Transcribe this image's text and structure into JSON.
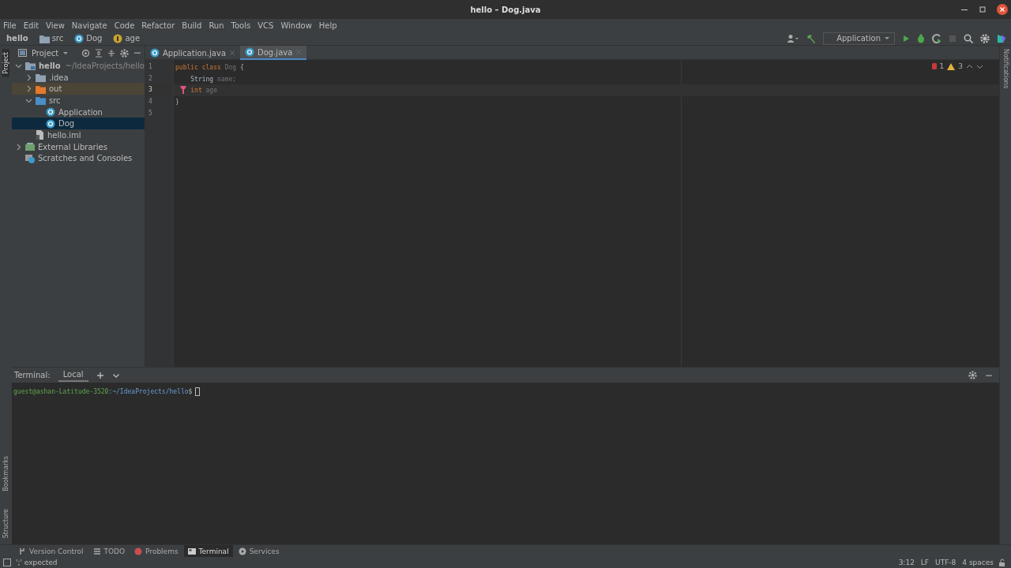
{
  "window": {
    "title": "hello – Dog.java"
  },
  "menu": [
    "File",
    "Edit",
    "View",
    "Navigate",
    "Code",
    "Refactor",
    "Build",
    "Run",
    "Tools",
    "VCS",
    "Window",
    "Help"
  ],
  "breadcrumbs": [
    {
      "label": "hello",
      "kind": "project"
    },
    {
      "label": "src",
      "kind": "folder"
    },
    {
      "label": "Dog",
      "kind": "class"
    },
    {
      "label": "age",
      "kind": "field"
    }
  ],
  "run_config": "Application",
  "left_strip_top": [
    {
      "label": "Project",
      "selected": true
    }
  ],
  "left_strip_bottom": [
    {
      "label": "Bookmarks",
      "selected": false
    },
    {
      "label": "Structure",
      "selected": false
    }
  ],
  "right_strip": [
    {
      "label": "Notifications"
    }
  ],
  "project_panel": {
    "title": "Project",
    "tree": [
      {
        "label": "hello",
        "hint": "~/IdeaProjects/hello",
        "kind": "module",
        "expanded": true,
        "selected": false,
        "children": [
          {
            "label": ".idea",
            "kind": "folder",
            "expanded": false,
            "selected": false
          },
          {
            "label": "out",
            "kind": "excluded",
            "expanded": false,
            "selected": false
          },
          {
            "label": "src",
            "kind": "source",
            "expanded": true,
            "selected": false,
            "children": [
              {
                "label": "Application",
                "kind": "class",
                "selected": false
              },
              {
                "label": "Dog",
                "kind": "class",
                "selected": true
              }
            ]
          },
          {
            "label": "hello.iml",
            "kind": "file",
            "selected": false
          }
        ]
      },
      {
        "label": "External Libraries",
        "kind": "libraries",
        "expanded": false,
        "selected": false
      },
      {
        "label": "Scratches and Consoles",
        "kind": "scratches",
        "selected": false
      }
    ]
  },
  "editor_tabs": [
    {
      "label": "Application.java",
      "selected": false
    },
    {
      "label": "Dog.java",
      "selected": true
    }
  ],
  "inspections": {
    "errors": "1",
    "warnings": "3"
  },
  "code": [
    {
      "number": "1",
      "current": false,
      "error": false,
      "tokens": [
        {
          "text": "public class ",
          "kind": "keyword"
        },
        {
          "text": "Dog ",
          "kind": "unused"
        },
        {
          "text": "{",
          "kind": "plain"
        }
      ]
    },
    {
      "number": "2",
      "current": false,
      "error": false,
      "tokens": [
        {
          "text": "    String ",
          "kind": "plain"
        },
        {
          "text": "name",
          "kind": "unused"
        },
        {
          "text": ";",
          "kind": "unused"
        }
      ]
    },
    {
      "number": "3",
      "current": true,
      "error": true,
      "tokens": [
        {
          "text": "    int ",
          "kind": "keyword"
        },
        {
          "text": "age",
          "kind": "unused"
        }
      ]
    },
    {
      "number": "4",
      "current": false,
      "error": false,
      "tokens": [
        {
          "text": "}",
          "kind": "plain"
        }
      ]
    },
    {
      "number": "5",
      "current": false,
      "error": false
    }
  ],
  "terminal": {
    "title": "Terminal:",
    "tabs": [
      {
        "label": "Local",
        "selected": true
      }
    ],
    "prompt_user": "guest@ashan-Latitude-3520",
    "prompt_path": ":~/IdeaProjects/hello",
    "prompt_end": "$"
  },
  "tool_windows": [
    {
      "label": "Version Control",
      "kind": "vcs",
      "selected": false
    },
    {
      "label": "TODO",
      "kind": "todo",
      "selected": false
    },
    {
      "label": "Problems",
      "kind": "problems",
      "selected": false
    },
    {
      "label": "Terminal",
      "kind": "terminal",
      "selected": true
    },
    {
      "label": "Services",
      "kind": "services",
      "selected": false
    }
  ],
  "status_bar": {
    "message": "';' expected",
    "items": [
      "3:12",
      "LF",
      "UTF-8",
      "4 spaces"
    ]
  }
}
